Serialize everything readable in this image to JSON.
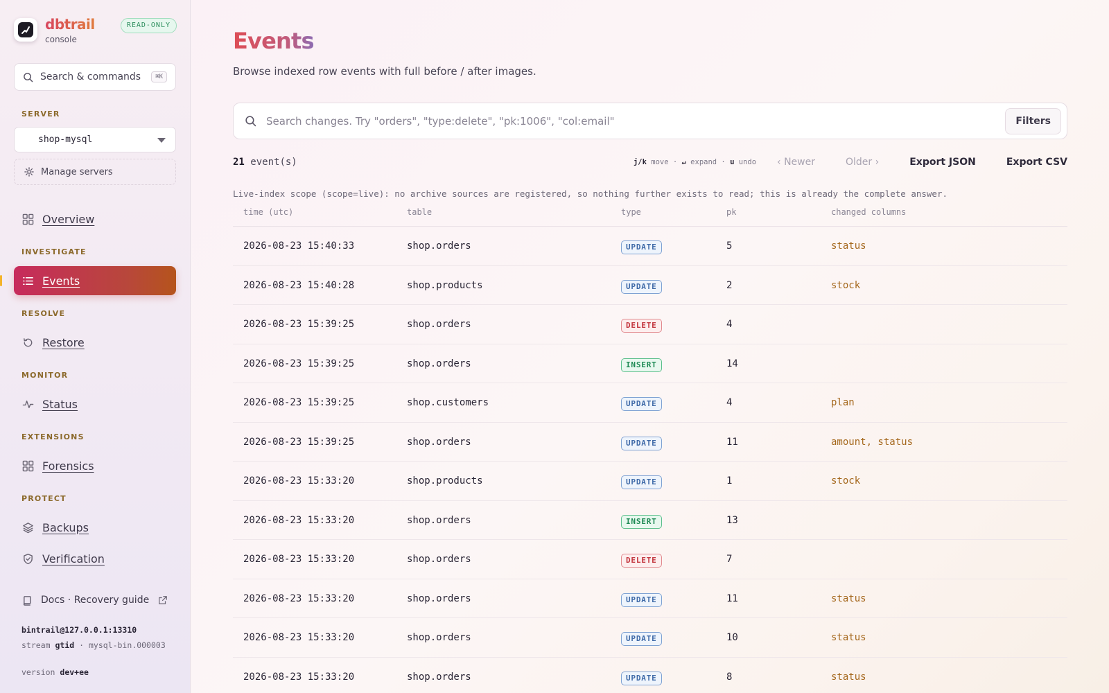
{
  "brand": {
    "name": "dbtrail",
    "sub": "console",
    "badge": "READ-ONLY"
  },
  "sidebar": {
    "search_label": "Search & commands",
    "search_shortcut": "⌘K",
    "server_section": "SERVER",
    "server_selected": "shop-mysql",
    "manage_servers": "Manage servers",
    "overview": "Overview",
    "sections": {
      "investigate": "INVESTIGATE",
      "resolve": "RESOLVE",
      "monitor": "MONITOR",
      "extensions": "EXTENSIONS",
      "protect": "PROTECT"
    },
    "items": {
      "events": "Events",
      "restore": "Restore",
      "status": "Status",
      "forensics": "Forensics",
      "backups": "Backups",
      "verification": "Verification"
    },
    "docs_label": "Docs · Recovery guide",
    "meta": {
      "host": "bintrail@127.0.0.1:13310",
      "stream_prefix": "stream",
      "stream_mode": "gtid",
      "stream_file": "· mysql-bin.000003",
      "version_prefix": "version",
      "version_value": "dev+ee"
    }
  },
  "main": {
    "title": "Events",
    "subtitle": "Browse indexed row events with full before / after images.",
    "search_placeholder": "Search changes. Try \"orders\", \"type:delete\", \"pk:1006\", \"col:email\"",
    "filters_label": "Filters",
    "count_value": "21",
    "count_suffix": "event(s)",
    "hints": {
      "k1": "j/k",
      "t1": "move ·",
      "k2": "↵",
      "t2": "expand ·",
      "k3": "u",
      "t3": "undo"
    },
    "newer_label": "‹ Newer",
    "older_label": "Older ›",
    "export_json": "Export JSON",
    "export_csv": "Export CSV",
    "scope_note": "Live-index scope (scope=live): no archive sources are registered, so nothing further exists to read; this is already the complete answer.",
    "columns": {
      "time": "time (utc)",
      "table": "table",
      "type": "type",
      "pk": "pk",
      "changed": "changed columns"
    },
    "type_colors": {
      "UPDATE": {
        "fg": "#3f6aa8",
        "bg": "#eef4fc",
        "border": "#7fa2d3"
      },
      "DELETE": {
        "fg": "#c3373f",
        "bg": "#fdeeee",
        "border": "#e28a8f"
      },
      "INSERT": {
        "fg": "#1f8a55",
        "bg": "#e8f8ef",
        "border": "#5cbf8b"
      }
    },
    "rows": [
      {
        "time": "2026-08-23 15:40:33",
        "table": "shop.orders",
        "type": "UPDATE",
        "pk": "5",
        "changed": "status"
      },
      {
        "time": "2026-08-23 15:40:28",
        "table": "shop.products",
        "type": "UPDATE",
        "pk": "2",
        "changed": "stock"
      },
      {
        "time": "2026-08-23 15:39:25",
        "table": "shop.orders",
        "type": "DELETE",
        "pk": "4",
        "changed": ""
      },
      {
        "time": "2026-08-23 15:39:25",
        "table": "shop.orders",
        "type": "INSERT",
        "pk": "14",
        "changed": ""
      },
      {
        "time": "2026-08-23 15:39:25",
        "table": "shop.customers",
        "type": "UPDATE",
        "pk": "4",
        "changed": "plan"
      },
      {
        "time": "2026-08-23 15:39:25",
        "table": "shop.orders",
        "type": "UPDATE",
        "pk": "11",
        "changed": "amount, status"
      },
      {
        "time": "2026-08-23 15:33:20",
        "table": "shop.products",
        "type": "UPDATE",
        "pk": "1",
        "changed": "stock"
      },
      {
        "time": "2026-08-23 15:33:20",
        "table": "shop.orders",
        "type": "INSERT",
        "pk": "13",
        "changed": ""
      },
      {
        "time": "2026-08-23 15:33:20",
        "table": "shop.orders",
        "type": "DELETE",
        "pk": "7",
        "changed": ""
      },
      {
        "time": "2026-08-23 15:33:20",
        "table": "shop.orders",
        "type": "UPDATE",
        "pk": "11",
        "changed": "status"
      },
      {
        "time": "2026-08-23 15:33:20",
        "table": "shop.orders",
        "type": "UPDATE",
        "pk": "10",
        "changed": "status"
      },
      {
        "time": "2026-08-23 15:33:20",
        "table": "shop.orders",
        "type": "UPDATE",
        "pk": "8",
        "changed": "status"
      }
    ]
  }
}
